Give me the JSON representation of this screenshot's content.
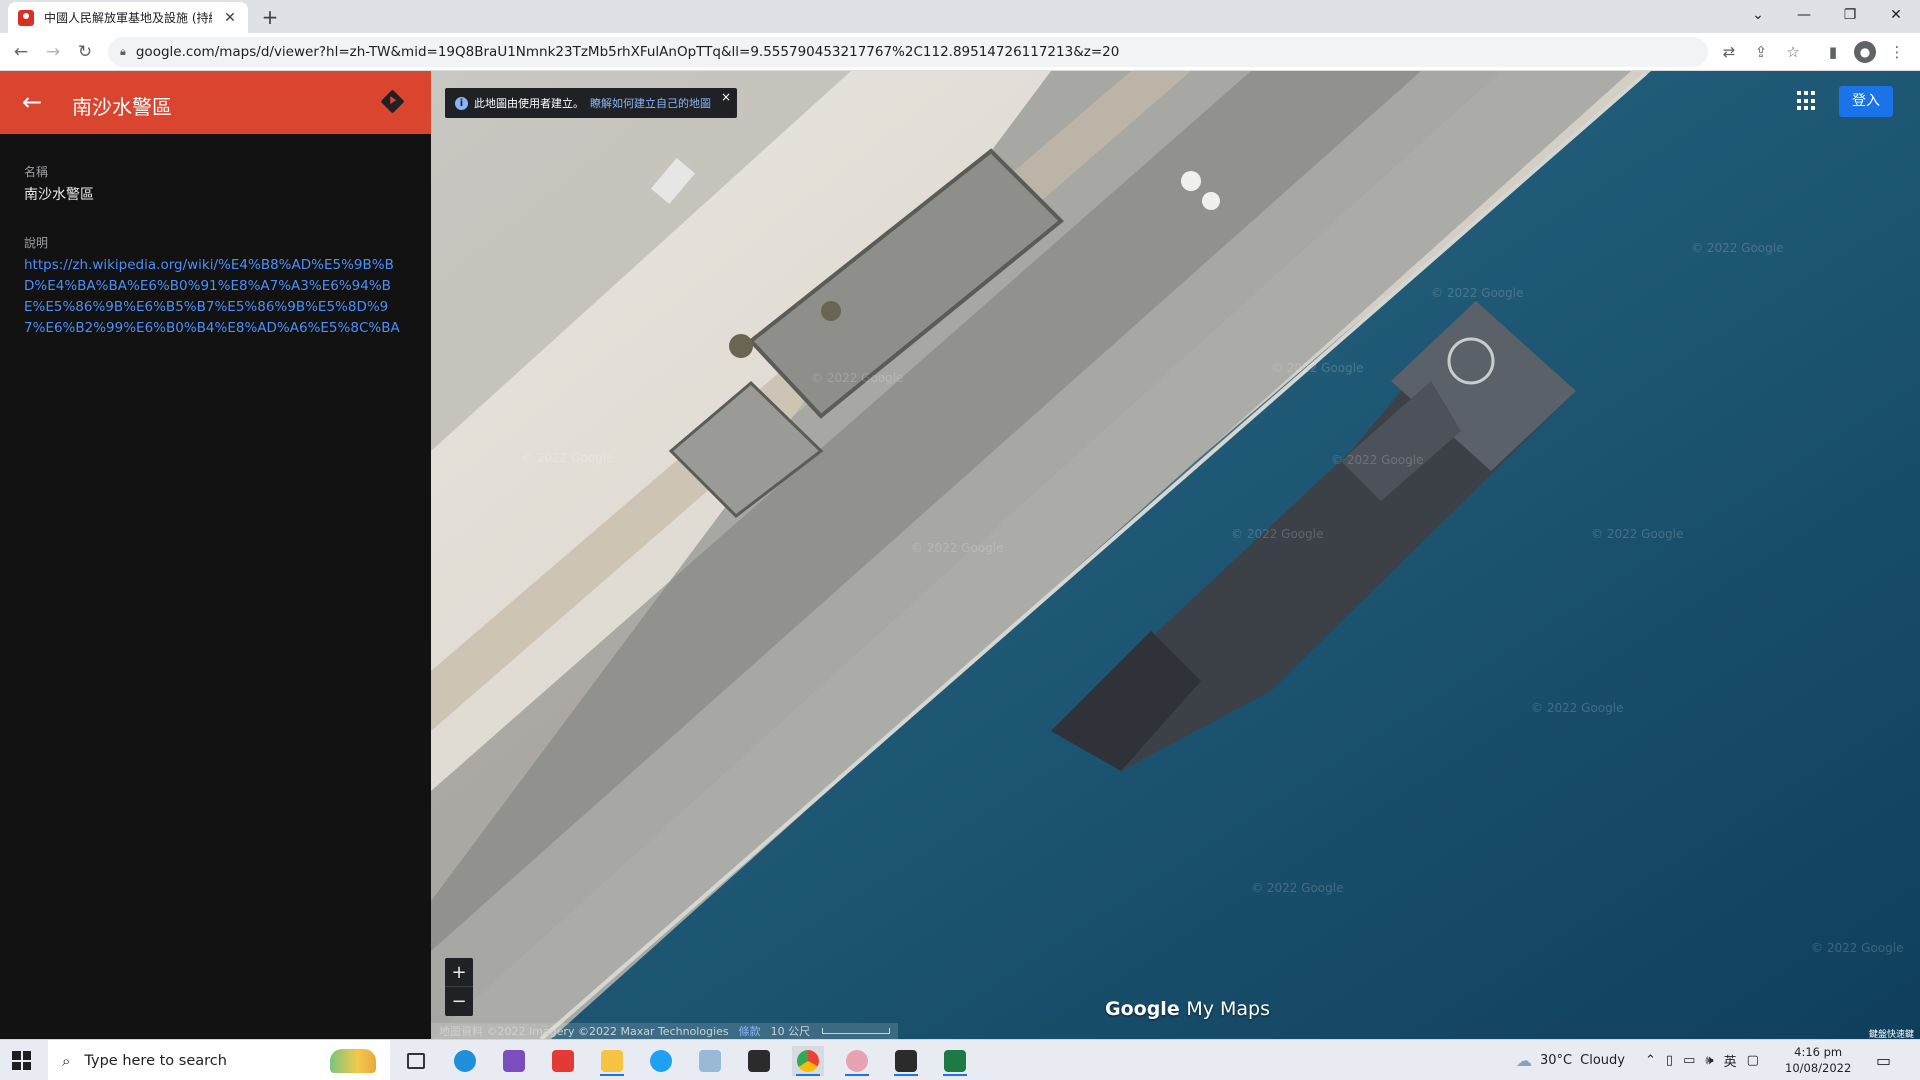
{
  "browser": {
    "tab_title": "中國人民解放軍基地及設施 (持續",
    "new_tab_label": "+",
    "url": "google.com/maps/d/viewer?hl=zh-TW&mid=19Q8BraU1Nmnk23TzMb5rhXFulAnOpTTq&ll=9.555790453217767%2C112.89514726117213&z=20"
  },
  "panel": {
    "title": "南沙水警區",
    "name_label": "名稱",
    "name_value": "南沙水警區",
    "desc_label": "說明",
    "desc_link": "https://zh.wikipedia.org/wiki/%E4%B8%AD%E5%9B%BD%E4%BA%BA%E6%B0%91%E8%A7%A3%E6%94%BE%E5%86%9B%E6%B5%B7%E5%86%9B%E5%8D%97%E6%B2%99%E6%B0%B4%E8%AD%A6%E5%8C%BA"
  },
  "map": {
    "notice_text": "此地圖由使用者建立。",
    "notice_link": "瞭解如何建立自己的地圖",
    "notice_close": "×",
    "signin_label": "登入",
    "zoom_in": "+",
    "zoom_out": "−",
    "attribution": "地圖資料 ©2022 Imagery ©2022 Maxar Technologies",
    "terms_link": "條款",
    "scale_label": "10 公尺",
    "logo_google": "Google",
    "logo_mymaps": "My Maps",
    "shortcut_label": "鍵盤快速鍵",
    "watermark_text": "© 2022 Google"
  },
  "taskbar": {
    "search_placeholder": "Type here to search",
    "weather_temp": "30°C",
    "weather_desc": "Cloudy",
    "lang": "英",
    "time": "4:16 pm",
    "date": "10/08/2022"
  }
}
